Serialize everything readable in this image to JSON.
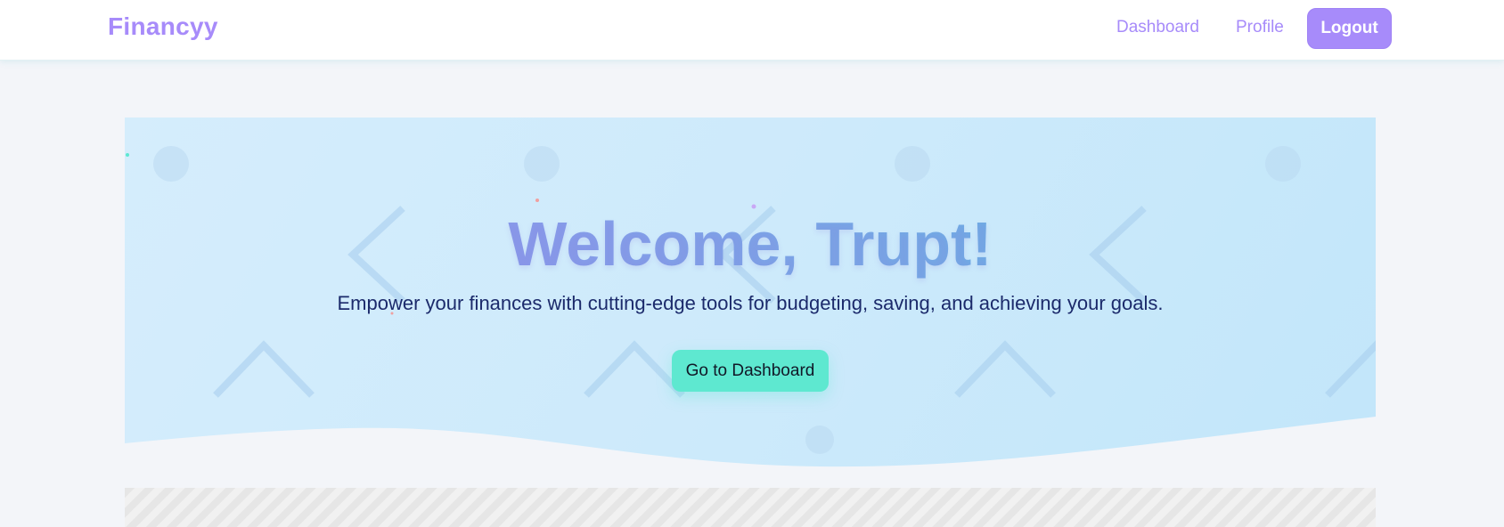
{
  "navbar": {
    "brand": "Financyy",
    "links": [
      {
        "label": "Dashboard"
      },
      {
        "label": "Profile"
      }
    ],
    "logout_label": "Logout"
  },
  "hero": {
    "title": "Welcome, Trupt!",
    "subtitle": "Empower your finances with cutting-edge tools for budgeting, saving, and achieving your goals.",
    "cta_label": "Go to Dashboard"
  },
  "colors": {
    "brand": "#a78bfa",
    "accent": "#5ee8d0",
    "hero_bg": "#cdeafb",
    "subtitle_text": "#1b2a6b"
  }
}
